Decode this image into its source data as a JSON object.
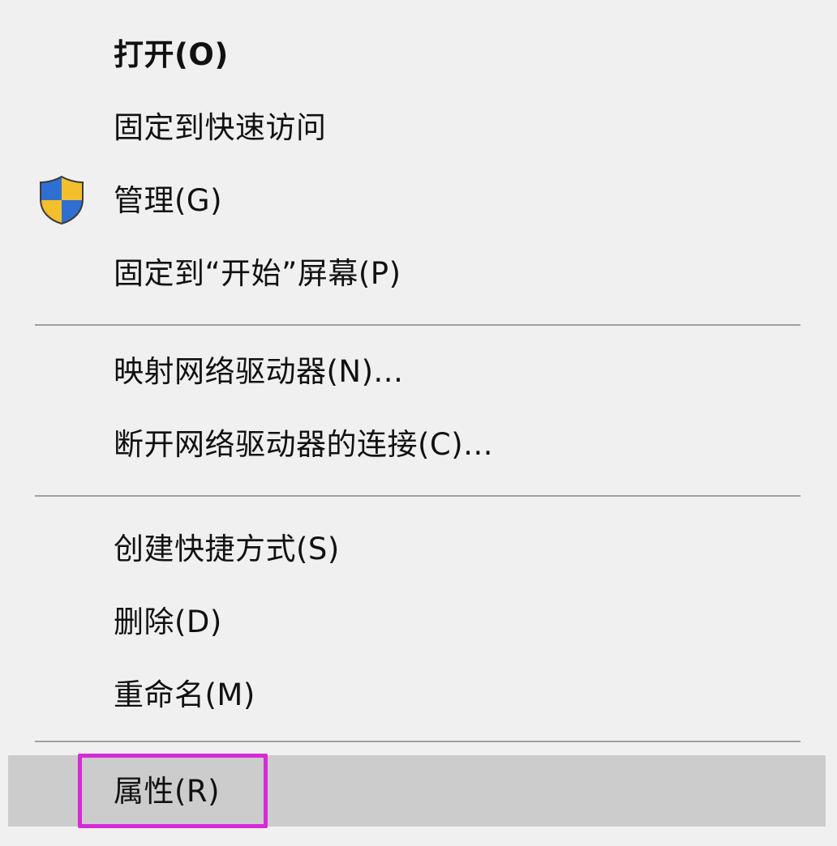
{
  "menu": {
    "items": [
      {
        "label": "打开(O)"
      },
      {
        "label": "固定到快速访问"
      },
      {
        "label": "管理(G)",
        "icon": "uac-shield-icon"
      },
      {
        "label": "固定到“开始”屏幕(P)"
      },
      {
        "label": "映射网络驱动器(N)..."
      },
      {
        "label": "断开网络驱动器的连接(C)..."
      },
      {
        "label": "创建快捷方式(S)"
      },
      {
        "label": "删除(D)"
      },
      {
        "label": "重命名(M)"
      },
      {
        "label": "属性(R)"
      }
    ]
  },
  "colors": {
    "menu_background": "#f0f0f0",
    "separator": "#a0a0a0",
    "hover_background": "#cccccc",
    "annotation_box": "#d62ad6",
    "shield_blue": "#2f6fd1",
    "shield_yellow": "#f2c02c"
  }
}
